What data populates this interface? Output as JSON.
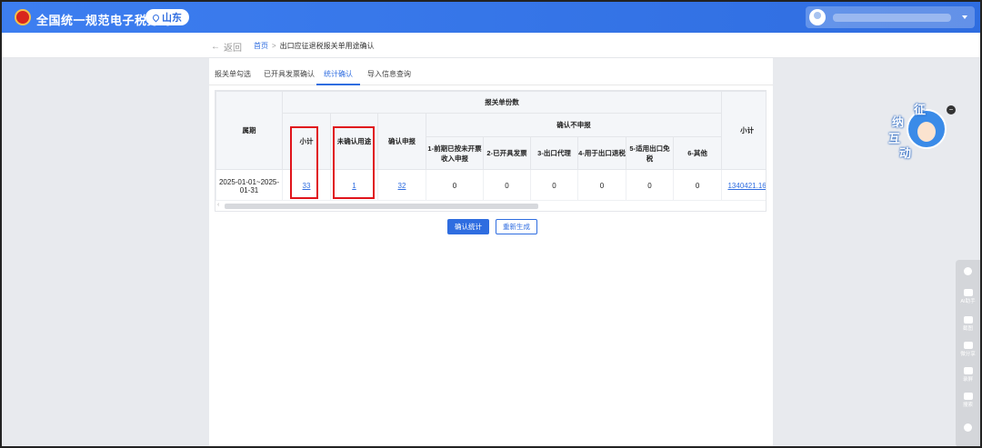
{
  "header": {
    "site_title": "全国统一规范电子税务局",
    "region": "山东"
  },
  "breadcrumb": {
    "back_label": "返回",
    "home": "首页",
    "separator": ">",
    "current": "出口应征退税报关单用途确认"
  },
  "tabs": [
    {
      "label": "报关单勾选",
      "active": false
    },
    {
      "label": "已开具发票确认",
      "active": false
    },
    {
      "label": "统计确认",
      "active": true
    },
    {
      "label": "导入信息查询",
      "active": false
    }
  ],
  "table": {
    "headers": {
      "period": "属期",
      "declaration_count": "报关单份数",
      "subtotal": "小计",
      "unconfirmed": "未确认用途",
      "confirm_declare": "确认申报",
      "confirm_not_declare": "确认不申报",
      "reasons": [
        "1-前期已按未开票收入申报",
        "2-已开具发票",
        "3-出口代理",
        "4-用于出口退税",
        "5-适用出口免税",
        "6-其他"
      ],
      "subtotal_right": "小计"
    },
    "rows": [
      {
        "period": "2025-01-01~2025-01-31",
        "subtotal": "33",
        "unconfirmed": "1",
        "confirm_declare": "32",
        "reasons": [
          "0",
          "0",
          "0",
          "0",
          "0",
          "0"
        ],
        "amount_subtotal": "1340421.16"
      }
    ]
  },
  "buttons": {
    "confirm_stats": "确认统计",
    "regenerate": "重新生成"
  },
  "mascot": {
    "chars": [
      "征",
      "纳",
      "互",
      "动"
    ]
  },
  "side_tools": [
    "AI助手",
    "截图",
    "微分享",
    "录屏",
    "搜索"
  ],
  "colors": {
    "brand_blue": "#2f6de0",
    "highlight_red": "#e0141b"
  }
}
